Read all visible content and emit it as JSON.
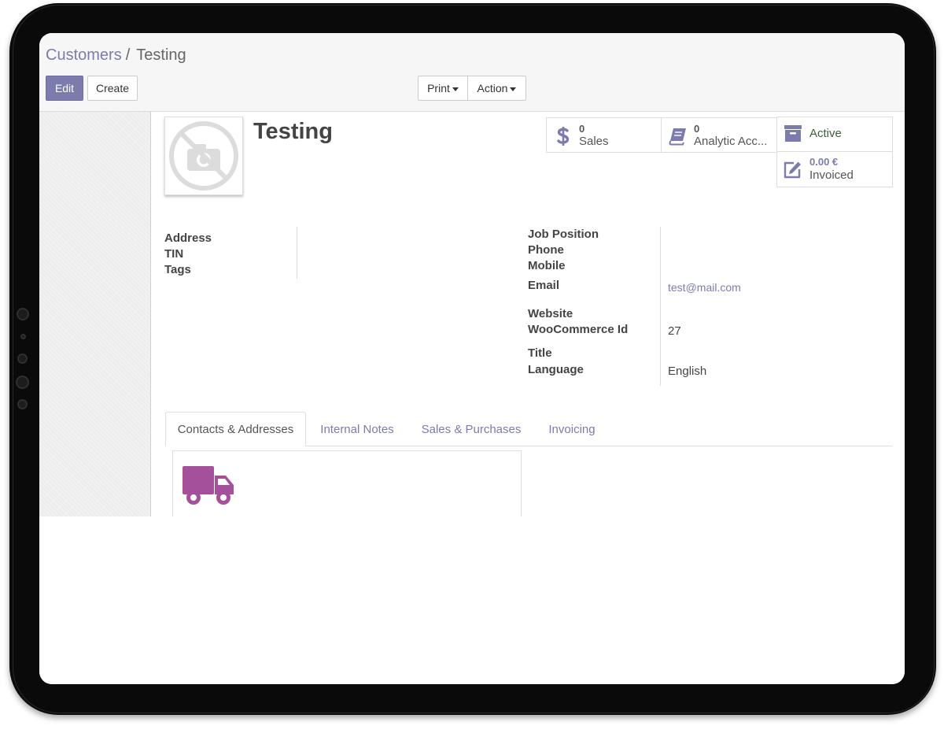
{
  "breadcrumb": {
    "parent": "Customers",
    "separator": "/",
    "current": "Testing"
  },
  "buttons": {
    "edit": "Edit",
    "create": "Create",
    "print": "Print",
    "action": "Action"
  },
  "partner": {
    "name": "Testing"
  },
  "stats": {
    "sales": {
      "value": "0",
      "label": "Sales"
    },
    "analytic": {
      "value": "0",
      "label": "Analytic Acc..."
    },
    "active": {
      "label": "Active"
    },
    "invoiced": {
      "value": "0.00 €",
      "label": "Invoiced"
    }
  },
  "fields_left": [
    "Address",
    "TIN",
    "Tags"
  ],
  "fields_right": {
    "job_position": {
      "label": "Job Position",
      "value": ""
    },
    "phone": {
      "label": "Phone",
      "value": ""
    },
    "mobile": {
      "label": "Mobile",
      "value": ""
    },
    "email": {
      "label": "Email",
      "value": "test@mail.com"
    },
    "website": {
      "label": "Website",
      "value": ""
    },
    "woocommerce_id": {
      "label": "WooCommerce Id",
      "value": "27"
    },
    "title": {
      "label": "Title",
      "value": ""
    },
    "language": {
      "label": "Language",
      "value": "English"
    }
  },
  "tabs": [
    {
      "label": "Contacts & Addresses",
      "active": true
    },
    {
      "label": "Internal Notes",
      "active": false
    },
    {
      "label": "Sales & Purchases",
      "active": false
    },
    {
      "label": "Invoicing",
      "active": false
    }
  ],
  "icons": {
    "sales": "dollar-icon",
    "analytic": "book-icon",
    "active": "archive-icon",
    "invoiced": "edit-icon",
    "avatar": "no-photo-icon",
    "address_card": "truck-icon"
  },
  "colors": {
    "accent": "#7c7bad",
    "truck": "#a5509a",
    "active_text": "#3a5f3a"
  }
}
